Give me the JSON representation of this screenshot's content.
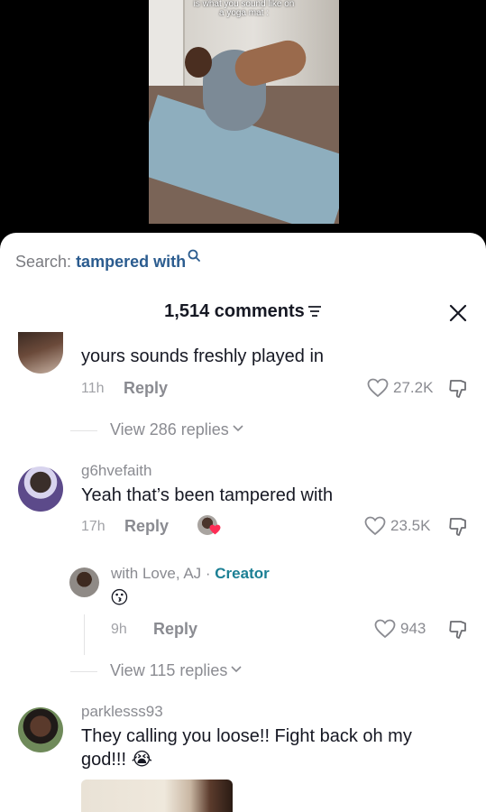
{
  "video": {
    "caption_line1": "is what you sound like on",
    "caption_line2": "a yoga mat :"
  },
  "search": {
    "prefix": "Search:",
    "term": "tampered with"
  },
  "comments_header": {
    "count_label": "1,514 comments"
  },
  "comments": [
    {
      "text": "yours sounds freshly played in",
      "time": "11h",
      "reply_label": "Reply",
      "likes": "27.2K",
      "view_replies": "View 286 replies"
    },
    {
      "username": "g6hvefaith",
      "text": "Yeah that’s been tampered with",
      "time": "17h",
      "reply_label": "Reply",
      "likes": "23.5K",
      "view_replies": "View 115 replies",
      "reply": {
        "username": "with Love, AJ",
        "separator": " · ",
        "creator_label": "Creator",
        "emoji": "😗",
        "time": "9h",
        "reply_label": "Reply",
        "likes": "943"
      }
    },
    {
      "username": "parklesss93",
      "text_line1": "They calling you loose!! Fight back oh my",
      "text_line2": "god!!!",
      "emoji": "😭"
    }
  ],
  "colors": {
    "accent_search": "#2b5c8f",
    "creator": "#1b7f94",
    "heart_badge": "#fe2c55"
  }
}
